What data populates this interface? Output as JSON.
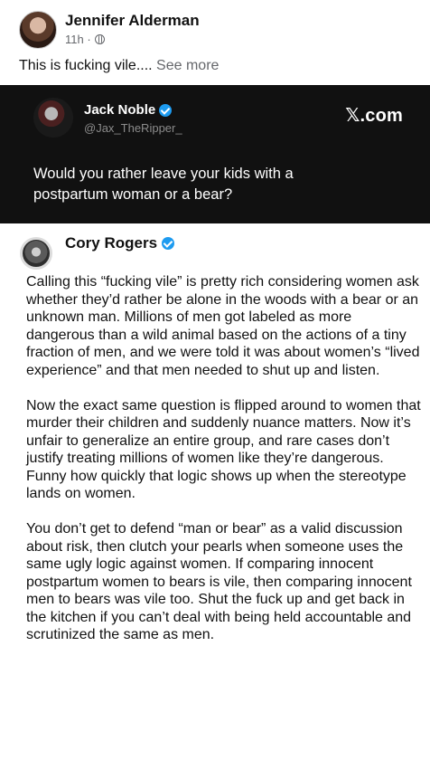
{
  "fb_post": {
    "author": "Jennifer Alderman",
    "time": "11h ·",
    "text": "This is fucking vile.... ",
    "see_more": "See more"
  },
  "x_post": {
    "name": "Jack Noble",
    "handle": "@Jax_TheRipper_",
    "site": "𝕏.com",
    "text": "Would you rather leave your kids with a postpartum woman or a bear?",
    "badge_color": "#1d9bf0"
  },
  "reply": {
    "name": "Cory Rogers",
    "paragraphs": [
      "Calling this “fucking vile” is pretty rich considering women ask whether they’d rather be alone in the woods with a bear or an unknown man. Millions of men got labeled as more dangerous than a wild animal based on the actions of a tiny fraction of men, and we were told it was about women’s “lived experience” and that men needed to shut up and listen.",
      "Now the exact same question is flipped around to women that murder their children and suddenly nuance matters. Now it’s unfair to generalize an entire group, and rare cases don’t justify treating millions of women like they’re dangerous. Funny how quickly that logic shows up when the stereotype lands on women.",
      "You don’t get to defend “man or bear” as a valid discussion about risk, then clutch your pearls when someone uses the same ugly logic against women. If comparing innocent postpartum women to bears is vile, then comparing innocent men to bears was vile too. Shut the fuck up and get back in the kitchen if you can’t deal with being held accountable and scrutinized the same as men."
    ]
  }
}
